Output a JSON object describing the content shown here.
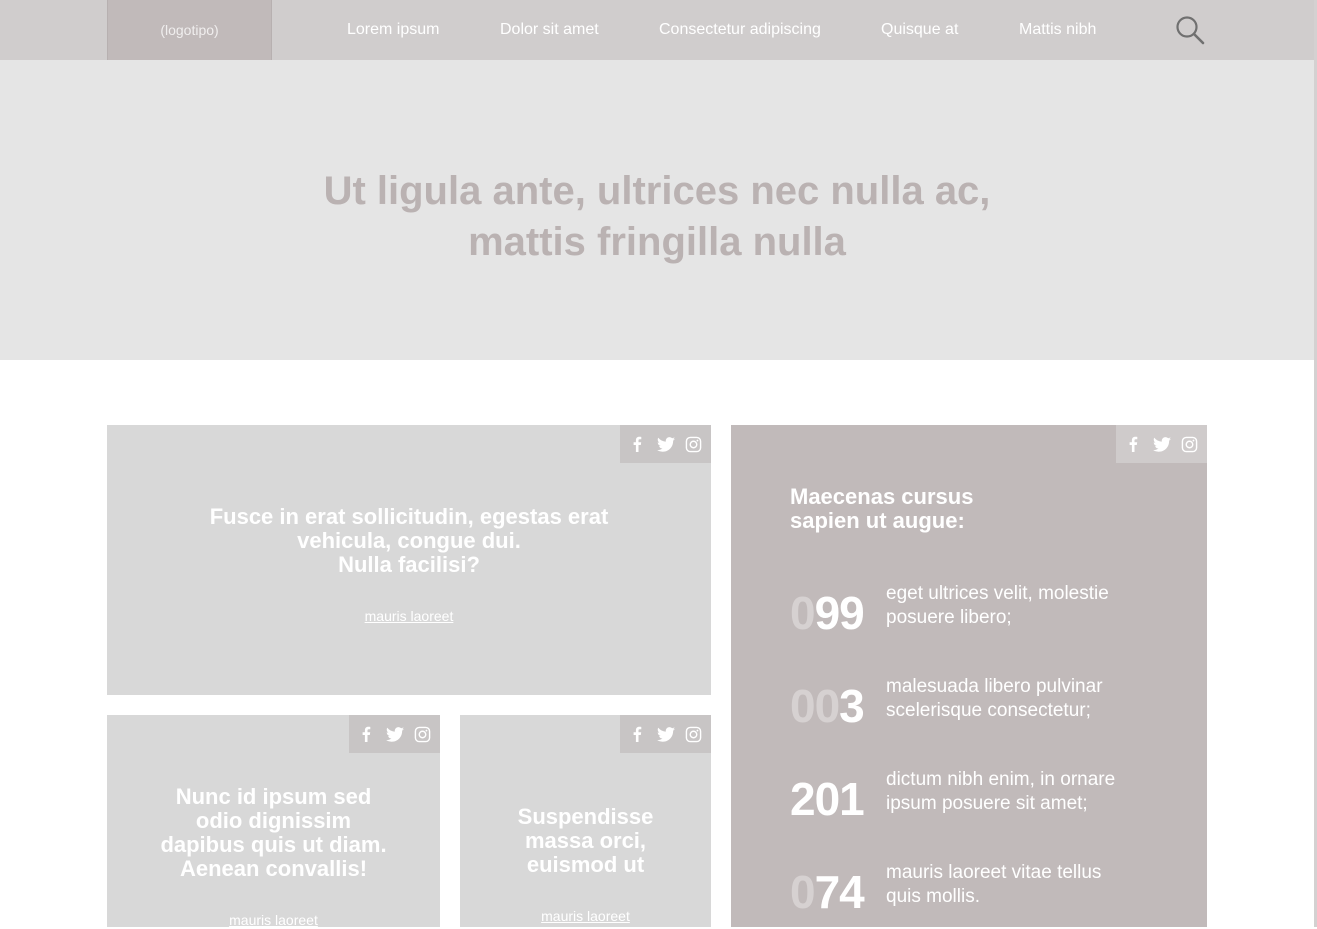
{
  "nav": {
    "logo": "(logotipo)",
    "items": [
      "Lorem ipsum",
      "Dolor sit amet",
      "Consectetur adipiscing",
      "Quisque at",
      "Mattis nibh"
    ],
    "search_icon": "search-icon"
  },
  "hero": {
    "title_line1": "Ut ligula ante, ultrices nec nulla ac,",
    "title_line2": "mattis fringilla nulla"
  },
  "social_icons": [
    "facebook-icon",
    "twitter-icon",
    "instagram-icon"
  ],
  "cards": {
    "featured": {
      "line1": "Fusce in erat sollicitudin, egestas erat",
      "line2": "vehicula, congue dui.",
      "line3": "Nulla facilisi?",
      "link": "mauris laoreet"
    },
    "small_left": {
      "line1": "Nunc id ipsum sed",
      "line2": "odio dignissim",
      "line3": "dapibus quis ut diam.",
      "line4": "Aenean convallis!",
      "link": "mauris laoreet"
    },
    "small_right": {
      "line1": "Suspendisse",
      "line2": "massa orci,",
      "line3": "euismod ut",
      "link": "mauris laoreet"
    },
    "stats": {
      "title_line1": "Maecenas cursus",
      "title_line2": "sapien ut augue:",
      "items": [
        {
          "dim": "0",
          "bold": "99",
          "line1": "eget ultrices velit, molestie",
          "line2": "posuere libero;"
        },
        {
          "dim": "00",
          "bold": "3",
          "line1": "malesuada libero pulvinar",
          "line2": "scelerisque consectetur;"
        },
        {
          "dim": "",
          "bold": "201",
          "line1": "dictum nibh enim, in ornare",
          "line2": "ipsum posuere sit amet;"
        },
        {
          "dim": "0",
          "bold": "74",
          "line1": "mauris laoreet vitae tellus",
          "line2": "quis mollis."
        }
      ]
    }
  },
  "colors": {
    "nav_bg": "#d0cdcd",
    "logo_bg": "#c1baba",
    "hero_bg": "#e5e5e5",
    "hero_text": "#bab2b2",
    "card_bg": "#d8d8d8",
    "stats_bg": "#c1baba"
  }
}
